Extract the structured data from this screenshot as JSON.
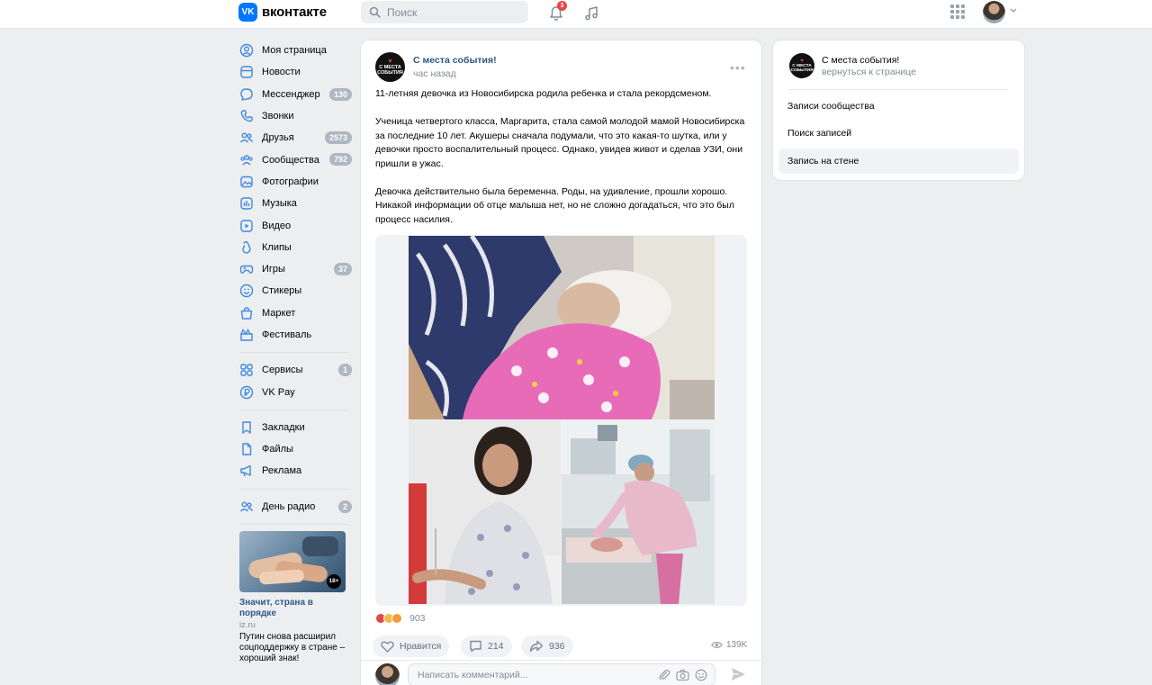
{
  "header": {
    "logo_letter": "VK",
    "logo_text": "вконтакте",
    "search_placeholder": "Поиск",
    "notifications_count": "3"
  },
  "sidebar": {
    "items": [
      {
        "label": "Моя страница",
        "icon": "user-circle-icon",
        "badge": ""
      },
      {
        "label": "Новости",
        "icon": "news-icon",
        "badge": ""
      },
      {
        "label": "Мессенджер",
        "icon": "messenger-icon",
        "badge": "130"
      },
      {
        "label": "Звонки",
        "icon": "phone-icon",
        "badge": ""
      },
      {
        "label": "Друзья",
        "icon": "friends-icon",
        "badge": "2573"
      },
      {
        "label": "Сообщества",
        "icon": "communities-icon",
        "badge": "792"
      },
      {
        "label": "Фотографии",
        "icon": "photo-icon",
        "badge": ""
      },
      {
        "label": "Музыка",
        "icon": "music-icon",
        "badge": ""
      },
      {
        "label": "Видео",
        "icon": "video-icon",
        "badge": ""
      },
      {
        "label": "Клипы",
        "icon": "clips-icon",
        "badge": ""
      },
      {
        "label": "Игры",
        "icon": "gamepad-icon",
        "badge": "37"
      },
      {
        "label": "Стикеры",
        "icon": "smile-icon",
        "badge": ""
      },
      {
        "label": "Маркет",
        "icon": "bag-icon",
        "badge": ""
      },
      {
        "label": "Фестиваль",
        "icon": "festival-icon",
        "badge": ""
      }
    ],
    "items2": [
      {
        "label": "Сервисы",
        "icon": "services-icon",
        "badge": "1"
      },
      {
        "label": "VK Pay",
        "icon": "vkpay-icon",
        "badge": ""
      }
    ],
    "items3": [
      {
        "label": "Закладки",
        "icon": "bookmark-icon",
        "badge": ""
      },
      {
        "label": "Файлы",
        "icon": "file-icon",
        "badge": ""
      },
      {
        "label": "Реклама",
        "icon": "megaphone-icon",
        "badge": ""
      }
    ],
    "items4": [
      {
        "label": "День радио",
        "icon": "people-icon",
        "badge": "2"
      }
    ],
    "promo": {
      "age": "18+",
      "title": "Значит, страна в порядке",
      "source": "iz.ru",
      "text": "Путин снова расширил соцподдержку в стране – хороший знак!"
    }
  },
  "post": {
    "avatar_text_1": "С МЕСТА",
    "avatar_text_2": "СОБЫТИЯ",
    "author": "С места события!",
    "time": "час назад",
    "paragraphs": [
      "11-летняя девочка из Новосибирска родила ребенка и стала рекордсменом.",
      "Ученица четвертого класса, Маргарита, стала самой молодой мамой Новосибирска за последние 10 лет. Акушеры сначала подумали, что это какая-то шутка, или у девочки просто воспалительный процесс. Однако, увидев живот и сделав УЗИ, они пришли в ужас.",
      "Девочка действительно была беременна. Роды, на удивление, прошли хорошо. Никакой информации об отце малыша нет, но не сложно догадаться, что это был процесс насилия."
    ],
    "reactions_count": "903",
    "like_label": "Нравится",
    "comments_count": "214",
    "shares_count": "936",
    "views": "139K",
    "comment_placeholder": "Написать комментарий..."
  },
  "right_panel": {
    "avatar_text_1": "С МЕСТА",
    "avatar_text_2": "СОБЫТИЯ",
    "name": "С места события!",
    "back_link": "вернуться к странице",
    "items": [
      "Записи сообщества",
      "Поиск записей",
      "Запись на стене"
    ],
    "active_item": "Запись на стене"
  },
  "colors": {
    "brand": "#0077ff",
    "link": "#2a5885",
    "badge": "#aeb7c2",
    "notification": "#e64646",
    "background": "#edeef0"
  }
}
